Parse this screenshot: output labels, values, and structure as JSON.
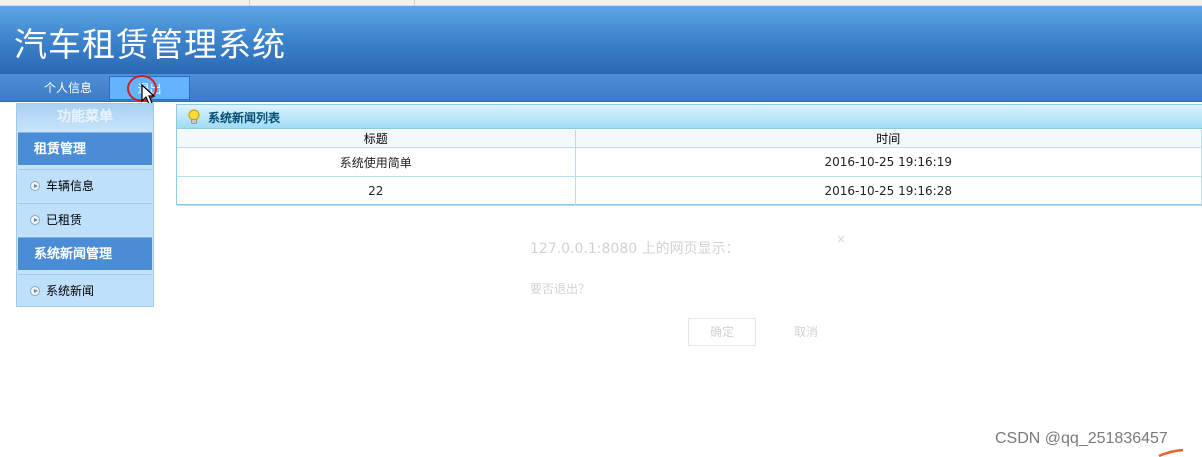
{
  "app": {
    "title": "汽车租赁管理系统"
  },
  "nav": {
    "items": [
      {
        "label": "个人信息"
      },
      {
        "label": "退出"
      }
    ]
  },
  "sidebar": {
    "caption": "功能菜单",
    "groups": [
      {
        "label": "租赁管理",
        "items": [
          {
            "label": "车辆信息"
          },
          {
            "label": "已租赁"
          }
        ]
      },
      {
        "label": "系统新闻管理",
        "items": [
          {
            "label": "系统新闻"
          }
        ]
      }
    ]
  },
  "panel": {
    "title": "系统新闻列表",
    "columns": [
      "标题",
      "时间"
    ],
    "rows": [
      {
        "title": "系统使用简单",
        "time": "2016-10-25 19:16:19"
      },
      {
        "title": "22",
        "time": "2016-10-25 19:16:28"
      }
    ]
  },
  "dialog": {
    "title": "127.0.0.1:8080 上的网页显示：",
    "close": "×",
    "message": "要否退出？",
    "ok_label": "确定",
    "cancel_label": "取消"
  },
  "watermark": "CSDN @qq_251836457",
  "colors": {
    "header_blue": "#3f86cf",
    "nav_blue": "#4f8fd6",
    "logout_button": "#63b3ff",
    "sidebar_group": "#4a8dd6",
    "sidebar_link": "#bfe0fb",
    "panel_head": "#9fdcf5",
    "cursor_ring": "#d71e1e"
  },
  "icons": {
    "cursor": "mouse-pointer-icon",
    "panel": "lightbulb-icon",
    "sidebar_link": "circle-arrow-icon"
  }
}
